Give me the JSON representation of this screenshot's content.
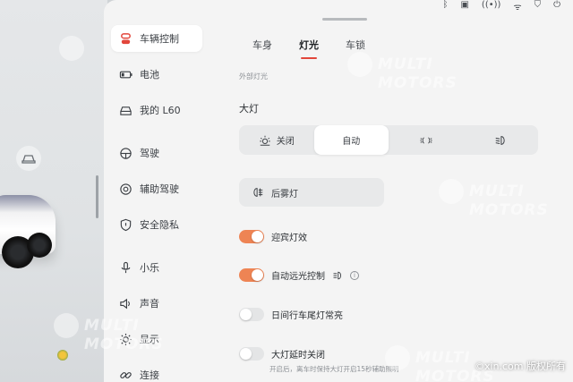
{
  "sidebar": {
    "items": [
      {
        "label": "车辆控制",
        "icon": "car-control-icon",
        "active": true
      },
      {
        "label": "电池",
        "icon": "battery-icon"
      },
      {
        "label": "我的 L60",
        "icon": "car-front-icon"
      },
      {
        "label": "驾驶",
        "icon": "steering-wheel-icon"
      },
      {
        "label": "辅助驾驶",
        "icon": "assisted-driving-icon"
      },
      {
        "label": "安全隐私",
        "icon": "shield-icon"
      },
      {
        "label": "小乐",
        "icon": "microphone-icon"
      },
      {
        "label": "声音",
        "icon": "speaker-icon"
      },
      {
        "label": "显示",
        "icon": "brightness-icon"
      },
      {
        "label": "连接",
        "icon": "link-icon"
      }
    ]
  },
  "tabs": [
    {
      "label": "车身"
    },
    {
      "label": "灯光",
      "active": true
    },
    {
      "label": "车锁"
    }
  ],
  "lighting": {
    "section_label": "外部灯光",
    "headlight_title": "大灯",
    "modes": [
      {
        "label": "关闭",
        "icon": "sun-outline-icon"
      },
      {
        "label": "自动",
        "active": true
      },
      {
        "label": "",
        "icon": "position-lights-icon"
      },
      {
        "label": "",
        "icon": "low-beam-icon"
      }
    ],
    "fog_label": "后雾灯",
    "toggles": [
      {
        "label": "迎宾灯效",
        "on": true
      },
      {
        "label": "自动远光控制",
        "on": true
      },
      {
        "label": "日间行车尾灯常亮",
        "on": false
      },
      {
        "label": "大灯延时关闭",
        "on": false
      }
    ],
    "delay_hint": "开启后，离车时保持大灯开启15秒辅助照明"
  },
  "watermark": {
    "brand_line1": "MULTI",
    "brand_line2": "MOTORS",
    "credit": "©xin.com 版权所有"
  },
  "colors": {
    "accent_tab": "#e2463b",
    "toggle_on": "#ee8454",
    "active_icon": "#e2463b"
  }
}
